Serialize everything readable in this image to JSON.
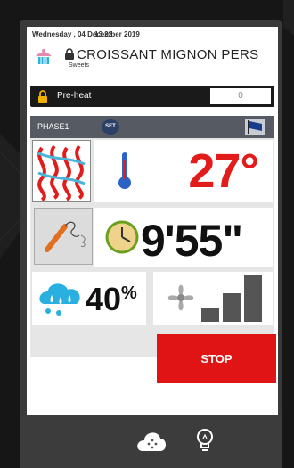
{
  "status": {
    "date": "Wednesday , 04 December 2019",
    "time": "13.22"
  },
  "recipe": {
    "title": "CROISSANT MIGNON PERS",
    "category": "Sweets"
  },
  "preheat": {
    "label": "Pre-heat",
    "value": "0"
  },
  "phase": {
    "name": "PHASE1",
    "set_label": "SET"
  },
  "cooking": {
    "temperature": "27°",
    "time": "9'55\"",
    "humidity": "40",
    "humidity_unit": "%",
    "fan_level": 3,
    "fan_levels_max": 3
  },
  "actions": {
    "stop_label": "STOP"
  },
  "colors": {
    "accent_red": "#e21b1b",
    "stop_red": "#e01414",
    "phase_bar": "#555a63",
    "drop_blue": "#2ab0e0"
  },
  "icons": [
    "cake-icon",
    "lock-icon",
    "flag-icon",
    "heat-waves-icon",
    "thermometer-icon",
    "probe-icon",
    "clock-icon",
    "humidity-drops-icon",
    "fan-icon",
    "fan-speed-bars-icon",
    "cloud-dots-icon",
    "lightbulb-icon"
  ]
}
